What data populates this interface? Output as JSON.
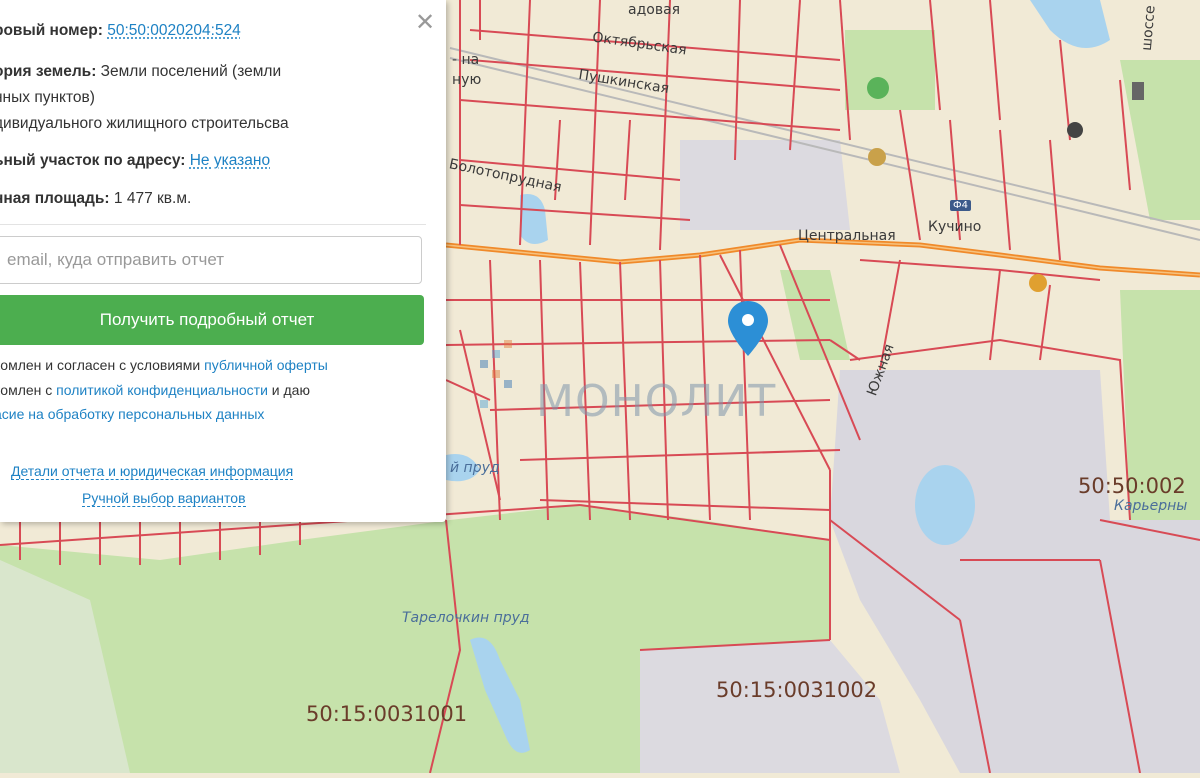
{
  "panel": {
    "cadastral_label": "ровый номер:",
    "cadastral_value": "50:50:0020204:524",
    "category_label": "ория земель:",
    "category_value_1": "Земли поселений (земли",
    "category_value_2": "нных пунктов)",
    "category_value_3": "дивидуального жилищного строительсва",
    "address_label": "ьный участок по адресу:",
    "address_value": "Не указано",
    "area_label": "нная площадь:",
    "area_value": "1 477 кв.м.",
    "email_placeholder": "email, куда отправить отчет",
    "submit_label": "Получить подробный отчет",
    "agree1_text": "комлен и согласен с условиями ",
    "agree1_link": "публичной оферты",
    "agree2_text": "комлен с ",
    "agree2_link": "политикой конфиденциальности",
    "agree2_tail": " и даю",
    "agree3_link": "асие на обработку персональных данных",
    "details_link": "Детали отчета и юридическая информация",
    "manual_link": "Ручной выбор вариантов"
  },
  "map": {
    "streets": {
      "sadovaya": "адовая",
      "oktyabrskaya": "Октябрьская",
      "pushkinskaya": "Пушкинская",
      "nu_fragment": "ную",
      "na_fragment": "- на",
      "bolotopr": "Болотопрудная",
      "centralnaya": "Центральная",
      "kuchino": "Кучино",
      "yuzhnaya": "Южная",
      "shosse_fragment": "шоссе",
      "road_badge": "Ф4"
    },
    "water": {
      "tarelochkin": "Тарелочкин пруд",
      "prud_fragment": "й пруд",
      "karernyi": "Карьерны"
    },
    "cadastral": {
      "q1": "50:15:0031001",
      "q2": "50:15:0031002",
      "q3": "50:50:002"
    },
    "watermark": "МОНОЛИТ",
    "colors": {
      "land": "#f1ead6",
      "forest": "#c3e0a8",
      "water": "#a9d3ee",
      "industrial": "#d6d4dc",
      "boundary": "#d84a55",
      "road": "#f08a2a",
      "pin": "#2c8fd6"
    }
  }
}
